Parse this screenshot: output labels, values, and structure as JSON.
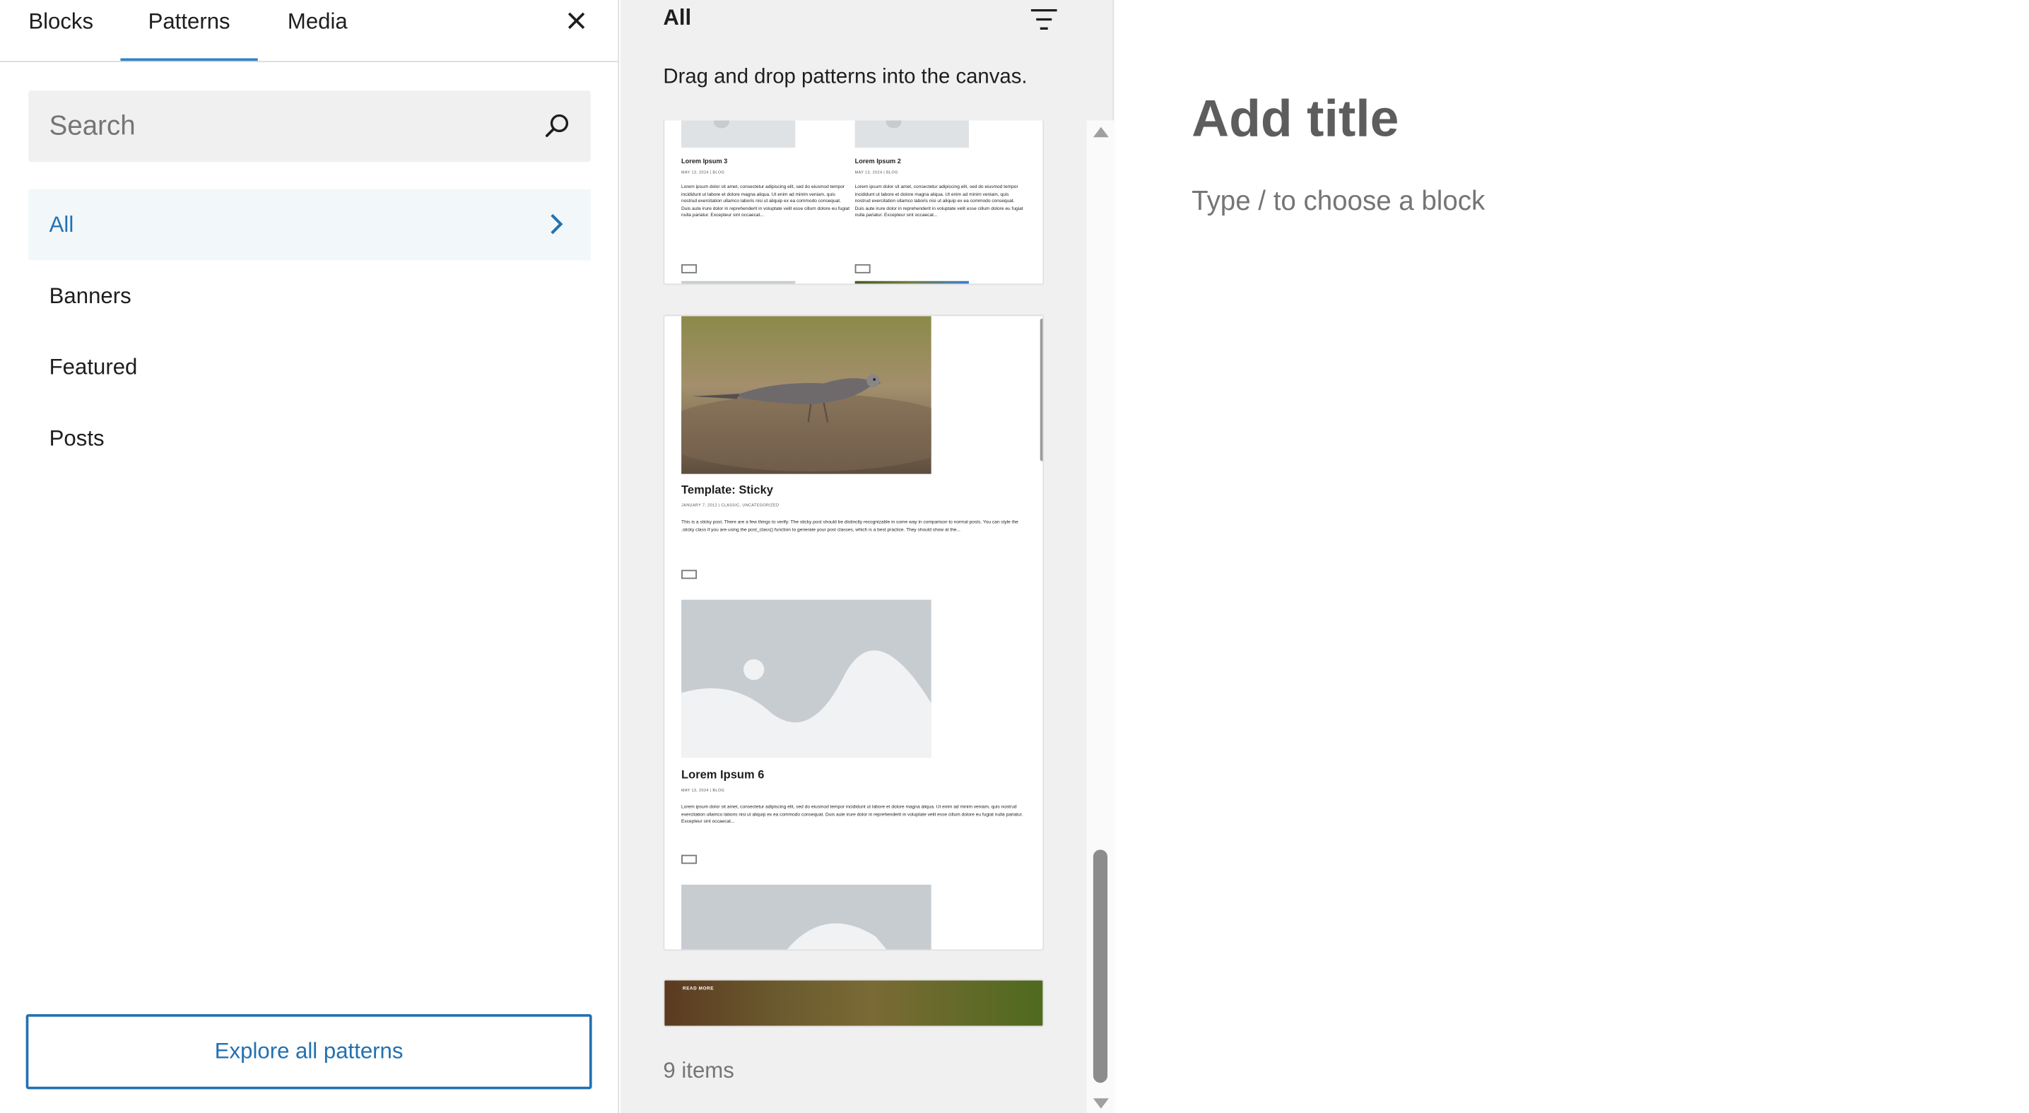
{
  "inserter": {
    "tabs": [
      "Blocks",
      "Patterns",
      "Media"
    ],
    "search_placeholder": "Search",
    "categories": [
      "All",
      "Banners",
      "Featured",
      "Posts"
    ],
    "explore_label": "Explore all patterns"
  },
  "patterns_panel": {
    "title": "All",
    "hint": "Drag and drop patterns into the canvas.",
    "count_label": "9 items",
    "cards": {
      "card1": {
        "post_a_title": "Lorem Ipsum 3",
        "post_a_meta": "MAY 13, 2024 | BLOG",
        "post_b_title": "Lorem Ipsum 2",
        "post_b_meta": "MAY 13, 2024 | BLOG",
        "excerpt": "Lorem ipsum dolor sit amet, consectetur adipiscing elit, sed do eiusmod tempor incididunt ut labore et dolore magna aliqua. Ut enim ad minim veniam, quis nostrud exercitation ullamco laboris nisi ut aliquip ex ea commodo consequat. Duis aute irure dolor in reprehenderit in voluptate velit esse cillum dolore eu fugiat nulla pariatur. Excepteur sint occaecat..."
      },
      "card2": {
        "post1_title": "Template: Sticky",
        "post1_meta": "JANUARY 7, 2012 | CLASSIC, UNCATEGORIZED",
        "post1_excerpt": "This is a sticky post. There are a few things to verify: The sticky post should be distinctly recognizable in some way in comparison to normal posts. You can style the .sticky class if you are using the post_class() function to generate your post classes, which is a best practice. They should show at the...",
        "post2_title": "Lorem Ipsum 6",
        "post2_meta": "MAY 13, 2024 | BLOG",
        "post2_excerpt": "Lorem ipsum dolor sit amet, consectetur adipiscing elit, sed do eiusmod tempor incididunt ut labore et dolore magna aliqua. Ut enim ad minim veniam, quis nostrud exercitation ullamco laboris nisi ut aliquip ex ea commodo consequat. Duis aute irure dolor in reprehenderit in voluptate velit esse cillum dolore eu fugiat nulla pariatur. Excepteur sint occaecat..."
      },
      "card3": {
        "label": "READ MORE"
      }
    }
  },
  "editor": {
    "title_placeholder": "Add title",
    "block_placeholder": "Type / to choose a block"
  },
  "colors": {
    "accent": "#2271b1",
    "active_bg": "#f2f7f9",
    "panel_bg": "#f0f0f0",
    "title_color": "#5d5d5d",
    "placeholder_gray": "#c7ccd1"
  }
}
